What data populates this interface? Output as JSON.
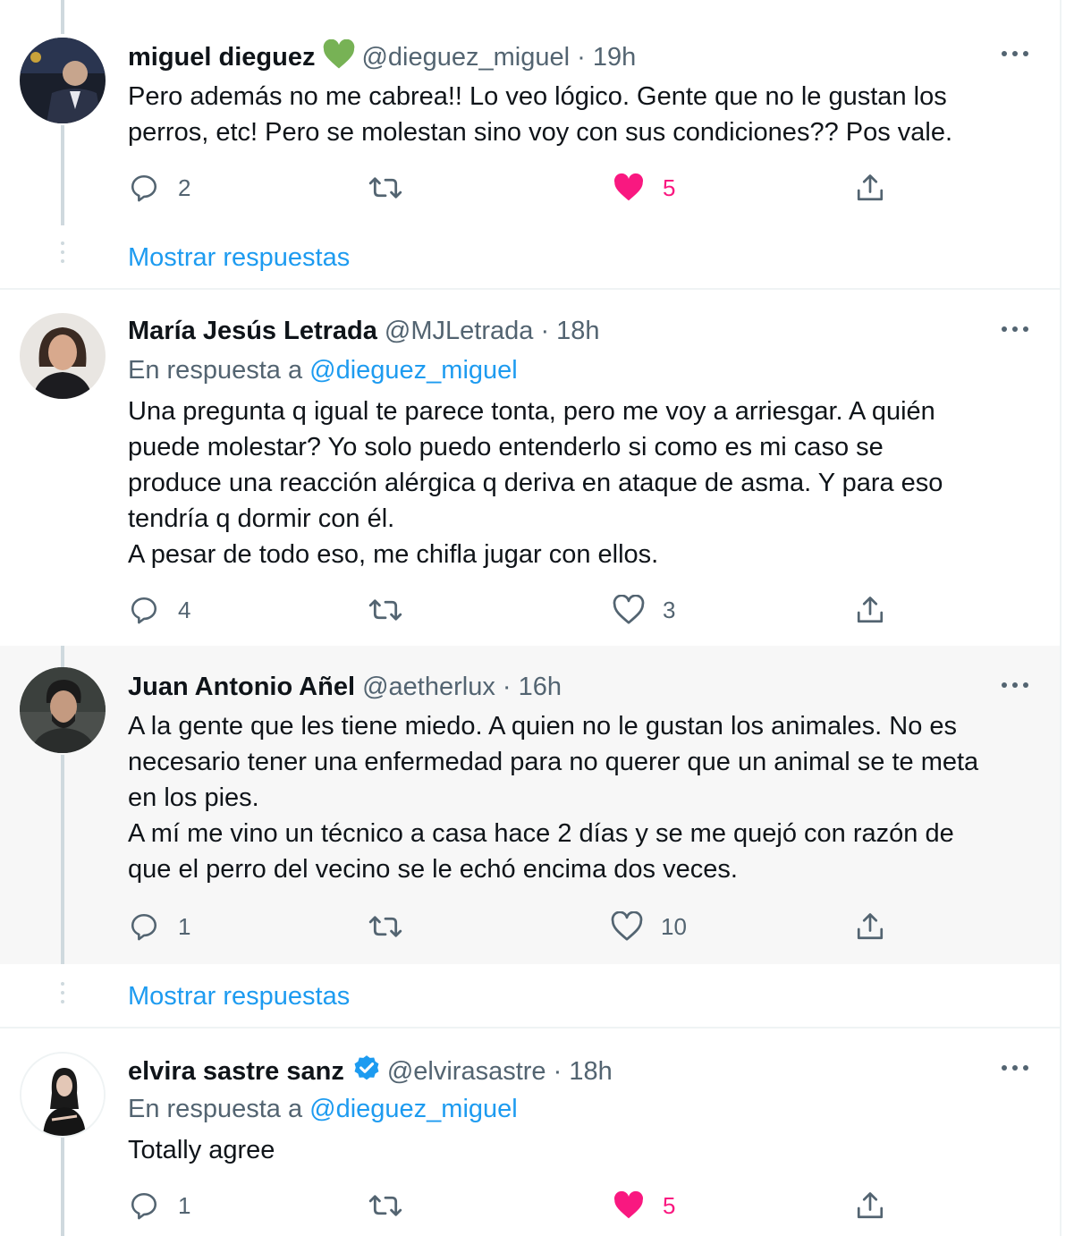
{
  "tweets": [
    {
      "name": "miguel dieguez",
      "badge": "green-heart-emoji",
      "handle": "@dieguez_miguel",
      "time": "· 19h",
      "reply_prefix": "",
      "reply_handle": "",
      "lines": [
        "Pero además no me cabrea!! Lo veo lógico. Gente que no le gustan los",
        "perros, etc! Pero se molestan sino voy con sus condiciones?? Pos vale."
      ],
      "replies": "2",
      "retweets": "",
      "likes": "5",
      "liked": true
    },
    {
      "name": "María Jesús Letrada",
      "badge": "",
      "handle": "@MJLetrada",
      "time": "· 18h",
      "reply_prefix": "En respuesta a",
      "reply_handle": "@dieguez_miguel",
      "lines": [
        "Una pregunta q igual te parece tonta, pero me voy a arriesgar. A quién",
        "puede molestar? Yo solo puedo entenderlo si como es mi caso se",
        "produce una reacción alérgica q deriva en ataque de asma. Y para eso",
        "tendría q dormir con él.",
        "A pesar de todo eso, me chifla jugar con ellos."
      ],
      "replies": "4",
      "retweets": "",
      "likes": "3",
      "liked": false
    },
    {
      "name": "Juan Antonio Añel",
      "badge": "",
      "handle": "@aetherlux",
      "time": "· 16h",
      "reply_prefix": "",
      "reply_handle": "",
      "lines": [
        "A la gente que les tiene miedo. A quien no le gustan los animales. No es",
        "necesario tener una enfermedad para no querer que un animal se te meta",
        "en los pies.",
        "A mí me vino un técnico a casa hace 2 días y se me quejó con razón de",
        "que el perro del vecino se le echó encima dos veces."
      ],
      "replies": "1",
      "retweets": "",
      "likes": "10",
      "liked": false
    },
    {
      "name": "elvira sastre sanz",
      "badge": "verified-badge",
      "handle": "@elvirasastre",
      "time": "· 18h",
      "reply_prefix": "En respuesta a",
      "reply_handle": "@dieguez_miguel",
      "lines": [
        "Totally agree"
      ],
      "replies": "1",
      "retweets": "",
      "likes": "5",
      "liked": true
    }
  ],
  "show_replies_label": "Mostrar respuestas",
  "icons": {
    "reply": "reply-icon",
    "retweet": "retweet-icon",
    "like": "heart-icon",
    "share": "share-icon",
    "more": "more-icon"
  },
  "colors": {
    "accent": "#1d9bf0",
    "like": "#f91880",
    "secondary_text": "#536471",
    "badge_green": "#77b255"
  }
}
